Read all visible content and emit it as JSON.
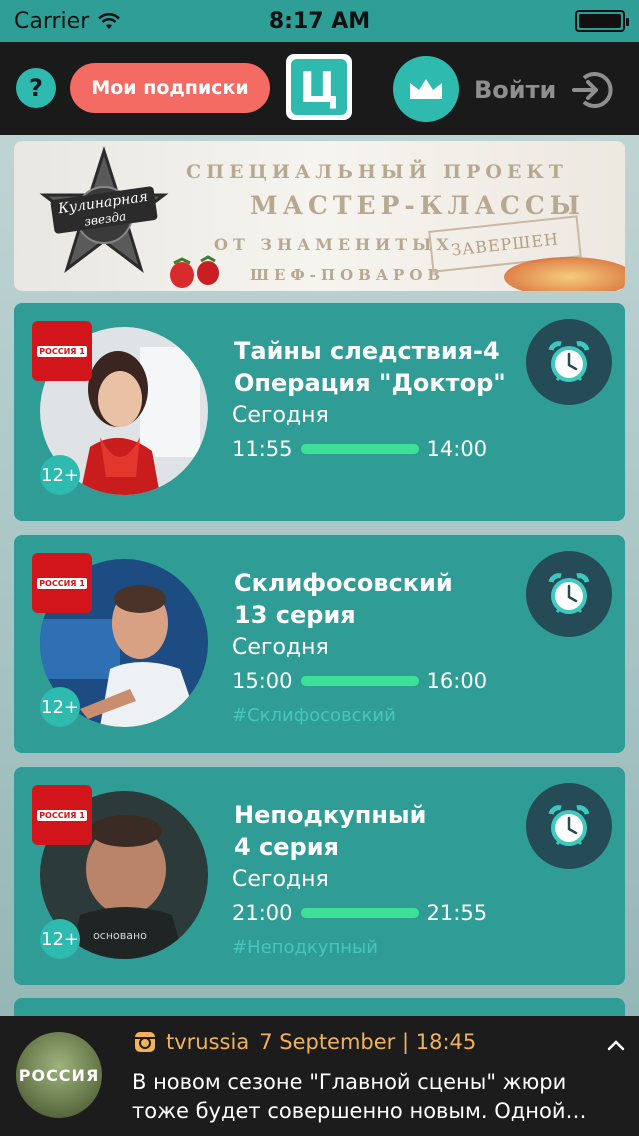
{
  "status_bar": {
    "carrier": "Carrier",
    "time": "8:17 AM"
  },
  "header": {
    "help_label": "?",
    "subscriptions_label": "Мои подписки",
    "logo_letter": "Ц",
    "login_label": "Войти"
  },
  "banner": {
    "badge_line1": "Кулинарная",
    "badge_line2": "звезда",
    "line1": "СПЕЦИАЛЬНЫЙ ПРОЕКТ",
    "line2": "МАСТЕР-КЛАССЫ",
    "line3": "ОТ ЗНАМЕНИТЫХ",
    "line4": "ШЕФ-ПОВАРОВ",
    "stamp": "ЗАВЕРШЕН"
  },
  "programs": [
    {
      "channel": "РОССИЯ 1",
      "title_line1": "Тайны следствия-4",
      "title_line2": "Операция \"Доктор\"",
      "day": "Сегодня",
      "start": "11:55",
      "end": "14:00",
      "progress": 1.0,
      "age": "12+",
      "tag": ""
    },
    {
      "channel": "РОССИЯ 1",
      "title_line1": "Склифосовский",
      "title_line2": "13 серия",
      "day": "Сегодня",
      "start": "15:00",
      "end": "16:00",
      "progress": 1.0,
      "age": "12+",
      "tag": "#Склифосовский"
    },
    {
      "channel": "РОССИЯ 1",
      "title_line1": "Неподкупный",
      "title_line2": "4 серия",
      "day": "Сегодня",
      "start": "21:00",
      "end": "21:55",
      "progress": 1.0,
      "age": "12+",
      "tag": "#Неподкупный"
    }
  ],
  "notification": {
    "avatar_text": "РОССИЯ",
    "handle": "tvrussia",
    "date": "7 September | 18:45",
    "body": "В новом сезоне \"Главной сцены\" жюри тоже будет совершенно новым. Одной…"
  },
  "colors": {
    "accent": "#2fbab0",
    "card": "#2f9d96",
    "subscribe": "#f36b62",
    "alarm_bg": "#254b56",
    "progress": "#3ce096"
  }
}
